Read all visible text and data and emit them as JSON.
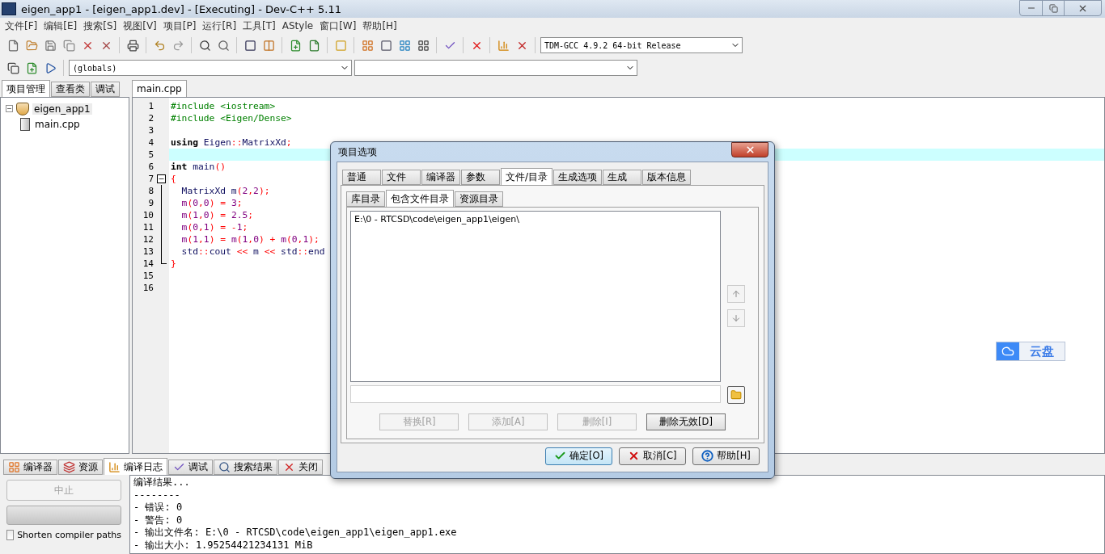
{
  "window": {
    "title": "eigen_app1 - [eigen_app1.dev] - [Executing] - Dev-C++ 5.11"
  },
  "menu": [
    "文件[F]",
    "编辑[E]",
    "搜索[S]",
    "视图[V]",
    "项目[P]",
    "运行[R]",
    "工具[T]",
    "AStyle",
    "窗口[W]",
    "帮助[H]"
  ],
  "compiler_select": {
    "value": "TDM-GCC 4.9.2 64-bit Release"
  },
  "scope_select": {
    "value": "(globals)"
  },
  "left_tabs": [
    {
      "label": "项目管理",
      "selected": true
    },
    {
      "label": "查看类",
      "selected": false
    },
    {
      "label": "调试",
      "selected": false
    }
  ],
  "project_tree": [
    {
      "label": "eigen_app1",
      "expanded": true,
      "children": [
        {
          "label": "main.cpp"
        }
      ]
    }
  ],
  "editor_tabs": [
    {
      "label": "main.cpp",
      "selected": true
    }
  ],
  "code_lines": [
    {
      "number": "1",
      "kind": "plain",
      "segments": [
        {
          "kind": "pp",
          "text": "#include <iostream>"
        }
      ]
    },
    {
      "number": "2",
      "kind": "plain",
      "segments": [
        {
          "kind": "pp",
          "text": "#include <Eigen/Dense>"
        }
      ]
    },
    {
      "number": "3",
      "kind": "plain"
    },
    {
      "number": "4",
      "kind": "plain",
      "segments": [
        {
          "kind": "kw",
          "text": "using"
        },
        {
          "kind": "id",
          "text": " Eigen"
        },
        {
          "kind": "sym",
          "text": "::"
        },
        {
          "kind": "id",
          "text": "MatrixXd"
        },
        {
          "kind": "sym",
          "text": ";"
        }
      ]
    },
    {
      "number": "5",
      "kind": "plain",
      "current": true
    },
    {
      "number": "6",
      "kind": "plain",
      "segments": [
        {
          "kind": "kw",
          "text": "int"
        },
        {
          "kind": "id",
          "text": " main"
        },
        {
          "kind": "sym",
          "text": "()"
        }
      ]
    },
    {
      "number": "7",
      "kind": "foldstart",
      "segments": [
        {
          "kind": "sym",
          "text": "{"
        }
      ]
    },
    {
      "number": "8",
      "kind": "foldbody",
      "segments": [
        {
          "kind": "id",
          "text": "  MatrixXd m"
        },
        {
          "kind": "sym",
          "text": "("
        },
        {
          "kind": "num",
          "text": "2"
        },
        {
          "kind": "sym",
          "text": ","
        },
        {
          "kind": "num",
          "text": "2"
        },
        {
          "kind": "sym",
          "text": ");"
        }
      ]
    },
    {
      "number": "9",
      "kind": "foldbody",
      "segments": [
        {
          "kind": "num",
          "text": "  m"
        },
        {
          "kind": "sym",
          "text": "("
        },
        {
          "kind": "num",
          "text": "0"
        },
        {
          "kind": "sym",
          "text": ","
        },
        {
          "kind": "num",
          "text": "0"
        },
        {
          "kind": "sym",
          "text": ") = "
        },
        {
          "kind": "num",
          "text": "3"
        },
        {
          "kind": "sym",
          "text": ";"
        }
      ]
    },
    {
      "number": "10",
      "kind": "foldbody",
      "segments": [
        {
          "kind": "num",
          "text": "  m"
        },
        {
          "kind": "sym",
          "text": "("
        },
        {
          "kind": "num",
          "text": "1"
        },
        {
          "kind": "sym",
          "text": ","
        },
        {
          "kind": "num",
          "text": "0"
        },
        {
          "kind": "sym",
          "text": ") = "
        },
        {
          "kind": "num",
          "text": "2.5"
        },
        {
          "kind": "sym",
          "text": ";"
        }
      ]
    },
    {
      "number": "11",
      "kind": "foldbody",
      "segments": [
        {
          "kind": "num",
          "text": "  m"
        },
        {
          "kind": "sym",
          "text": "("
        },
        {
          "kind": "num",
          "text": "0"
        },
        {
          "kind": "sym",
          "text": ","
        },
        {
          "kind": "num",
          "text": "1"
        },
        {
          "kind": "sym",
          "text": ") = -"
        },
        {
          "kind": "num",
          "text": "1"
        },
        {
          "kind": "sym",
          "text": ";"
        }
      ]
    },
    {
      "number": "12",
      "kind": "foldbody",
      "segments": [
        {
          "kind": "num",
          "text": "  m"
        },
        {
          "kind": "sym",
          "text": "("
        },
        {
          "kind": "num",
          "text": "1"
        },
        {
          "kind": "sym",
          "text": ","
        },
        {
          "kind": "num",
          "text": "1"
        },
        {
          "kind": "sym",
          "text": ") = "
        },
        {
          "kind": "num",
          "text": "m"
        },
        {
          "kind": "sym",
          "text": "("
        },
        {
          "kind": "num",
          "text": "1"
        },
        {
          "kind": "sym",
          "text": ","
        },
        {
          "kind": "num",
          "text": "0"
        },
        {
          "kind": "sym",
          "text": ") + "
        },
        {
          "kind": "num",
          "text": "m"
        },
        {
          "kind": "sym",
          "text": "("
        },
        {
          "kind": "num",
          "text": "0"
        },
        {
          "kind": "sym",
          "text": ","
        },
        {
          "kind": "num",
          "text": "1"
        },
        {
          "kind": "sym",
          "text": ");"
        }
      ]
    },
    {
      "number": "13",
      "kind": "foldbody",
      "segments": [
        {
          "kind": "id",
          "text": "  std"
        },
        {
          "kind": "sym",
          "text": "::"
        },
        {
          "kind": "id",
          "text": "cout"
        },
        {
          "kind": "sym",
          "text": " << "
        },
        {
          "kind": "id",
          "text": "m"
        },
        {
          "kind": "sym",
          "text": " << "
        },
        {
          "kind": "id",
          "text": "std"
        },
        {
          "kind": "sym",
          "text": "::"
        },
        {
          "kind": "id",
          "text": "end"
        }
      ]
    },
    {
      "number": "14",
      "kind": "foldend",
      "segments": [
        {
          "kind": "sym",
          "text": "}"
        }
      ]
    },
    {
      "number": "15",
      "kind": "plain"
    },
    {
      "number": "16",
      "kind": "plain"
    }
  ],
  "bottom_tabs": [
    {
      "label": "编译器",
      "selected": false
    },
    {
      "label": "资源",
      "selected": false
    },
    {
      "label": "编译日志",
      "selected": true
    },
    {
      "label": "调试",
      "selected": false
    },
    {
      "label": "搜索结果",
      "selected": false
    },
    {
      "label": "关闭",
      "selected": false
    }
  ],
  "abort_button": {
    "label": "中止",
    "disabled": true
  },
  "progress": {
    "level": 0
  },
  "shorten_paths": {
    "label": "Shorten compiler paths",
    "checked": false
  },
  "compile_log": [
    "编译结果...",
    "--------",
    "- 错误: 0",
    "- 警告: 0",
    "- 输出文件名: E:\\0 - RTCSD\\code\\eigen_app1\\eigen_app1.exe",
    "- 输出大小: 1.95254421234131 MiB"
  ],
  "dialog": {
    "title": "项目选项",
    "tabs": [
      {
        "label": "普通",
        "selected": false
      },
      {
        "label": "文件",
        "selected": false
      },
      {
        "label": "编译器",
        "selected": false
      },
      {
        "label": "参数",
        "selected": false
      },
      {
        "label": "文件/目录",
        "selected": true
      },
      {
        "label": "生成选项",
        "selected": false
      },
      {
        "label": "生成",
        "selected": false
      },
      {
        "label": "版本信息",
        "selected": false
      }
    ],
    "subtabs": [
      {
        "label": "库目录",
        "selected": false
      },
      {
        "label": "包含文件目录",
        "selected": true
      },
      {
        "label": "资源目录",
        "selected": false
      }
    ],
    "directories": [
      "E:\\0 - RTCSD\\code\\eigen_app1\\eigen\\"
    ],
    "actions": [
      {
        "label": "替换[R]",
        "disabled": true
      },
      {
        "label": "添加[A]",
        "disabled": true
      },
      {
        "label": "删除[I]",
        "disabled": true
      },
      {
        "label": "删除无效[D]",
        "disabled": false
      }
    ],
    "footer_buttons": [
      {
        "label": "确定[O]",
        "default": true
      },
      {
        "label": "取消[C]",
        "default": false
      },
      {
        "label": "帮助[H]",
        "default": false
      }
    ]
  },
  "cloud_widget": {
    "label": "云盘"
  }
}
